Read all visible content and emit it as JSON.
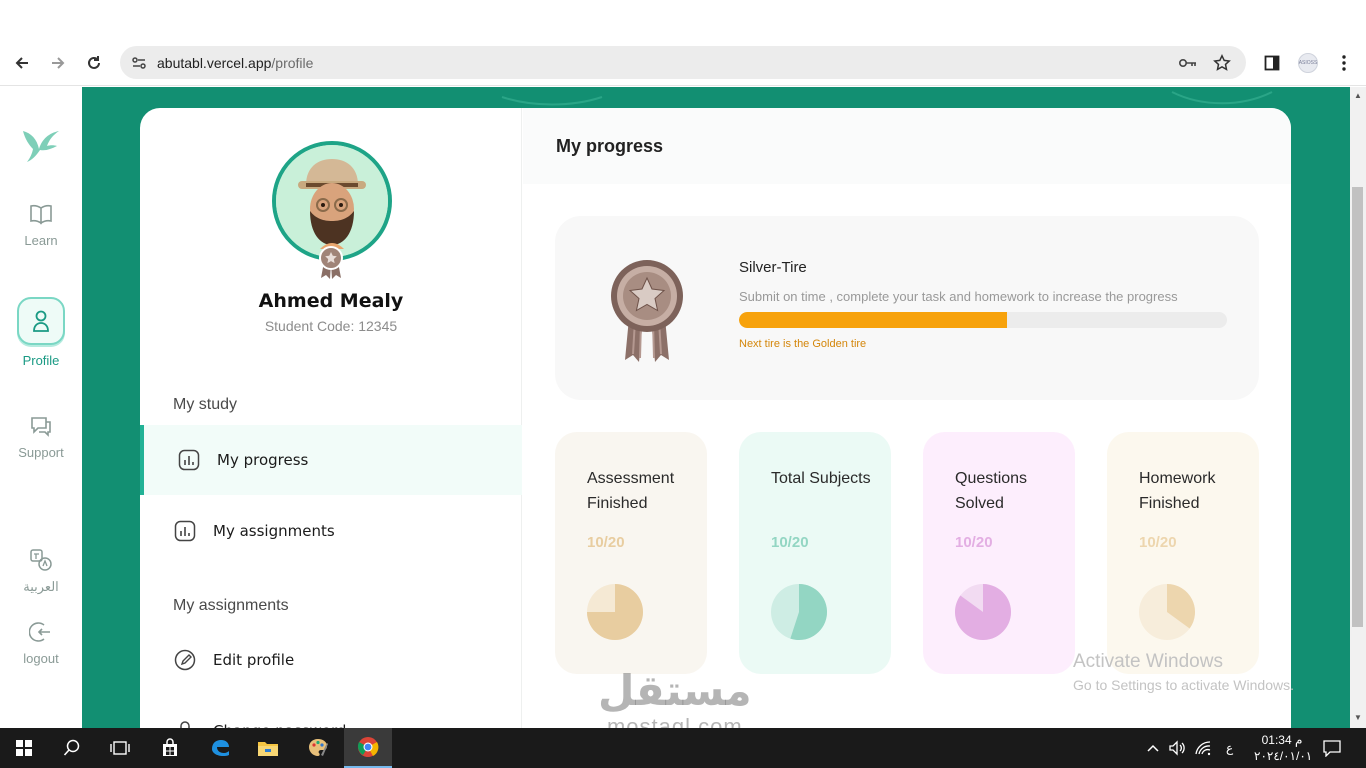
{
  "browser": {
    "url_host": "abutabl.vercel.app",
    "url_path": "/profile",
    "profile_chip": "ASIOSS"
  },
  "sidebar": {
    "items": [
      {
        "label": "Learn"
      },
      {
        "label": "Profile"
      },
      {
        "label": "Support"
      },
      {
        "label": "العربية"
      },
      {
        "label": "logout"
      }
    ]
  },
  "profile": {
    "name": "Ahmed Mealy",
    "code": "Student Code: 12345"
  },
  "menu": {
    "section_study": "My study",
    "progress": "My progress",
    "assignments": "My assignments",
    "section_assignments": "My assignments",
    "edit_profile": "Edit profile",
    "change_password": "Change password"
  },
  "main": {
    "title": "My progress",
    "tier": {
      "title": "Silver-Tire",
      "description": "Submit on time , complete your task and homework to increase the progress",
      "progress": 0.55,
      "next": "Next tire is the Golden tire"
    },
    "stats": [
      {
        "label": "Assessment Finished",
        "value": "10/20",
        "bg": "#f9f6f0",
        "color": "#e8cda0",
        "fraction": 0.75
      },
      {
        "label": "Total Subjects",
        "value": "10/20",
        "bg": "#ebfaf5",
        "color": "#93d6c3",
        "fraction": 0.55
      },
      {
        "label": "Questions Solved",
        "value": "10/20",
        "bg": "#fdeefd",
        "color": "#e3aee3",
        "fraction": 0.85
      },
      {
        "label": "Homework Finished",
        "value": "10/20",
        "bg": "#fcf8ee",
        "color": "#edd6ae",
        "fraction": 0.35
      }
    ]
  },
  "overlay": {
    "activate_title": "Activate Windows",
    "activate_sub": "Go to Settings to activate Windows.",
    "watermark_ar": "مستقل",
    "watermark_en": "mostaql.com"
  },
  "taskbar": {
    "lang": "ع",
    "time": "01:34 م",
    "date": "٢٠٢٤/٠١/٠١"
  }
}
